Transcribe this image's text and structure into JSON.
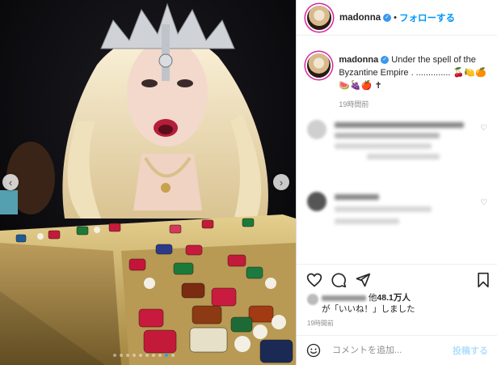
{
  "post": {
    "username": "madonna",
    "follow_label": "フォローする",
    "caption_text": "Under the spell of the Byzantine Empire . ..............",
    "caption_emojis": "🍒🍋🍊 🍉🍇🍎 ✝",
    "caption_time": "19時間前",
    "likes_prefix": "他",
    "likes_count": "48.1万人",
    "likes_suffix": "が「いいね！」しました",
    "post_time": "19時間前",
    "comment_placeholder": "コメントを追加...",
    "post_button": "投稿する"
  },
  "icons": [
    "verified-badge-icon",
    "heart-icon",
    "comment-icon",
    "share-icon",
    "bookmark-icon",
    "emoji-icon",
    "chevron-left-icon",
    "chevron-right-icon"
  ],
  "colors": {
    "link_blue": "#0095f6",
    "verified_blue": "#3897f0",
    "story_ring": "#d6249f"
  },
  "carousel": {
    "total": 10,
    "active_index": 8
  }
}
